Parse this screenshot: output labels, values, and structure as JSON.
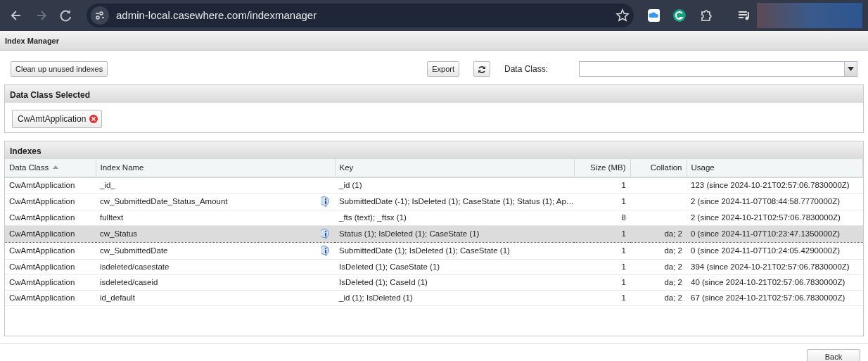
{
  "browser": {
    "url": "admin-local.casewhere.com/indexmanager"
  },
  "page": {
    "title": "Index Manager"
  },
  "toolbar": {
    "cleanup_button": "Clean up unused indexes",
    "export_button": "Export",
    "data_class_label": "Data Class:"
  },
  "selected_panel": {
    "title": "Data Class Selected",
    "tags": [
      "CwAmtApplication"
    ]
  },
  "indexes_panel": {
    "title": "Indexes",
    "columns": [
      {
        "label": "Data Class",
        "kind": "text",
        "sorted": true
      },
      {
        "label": "Index Name",
        "kind": "text",
        "sorted": false
      },
      {
        "label": "Key",
        "kind": "text",
        "sorted": false
      },
      {
        "label": "Size (MB)",
        "kind": "number",
        "sorted": false
      },
      {
        "label": "Collation",
        "kind": "number",
        "sorted": false
      },
      {
        "label": "Usage",
        "kind": "text",
        "sorted": false
      }
    ],
    "rows": [
      {
        "selected": false,
        "info": false,
        "cells": [
          "CwAmtApplication",
          "_id_",
          "_id (1)",
          "1",
          "",
          "123 (since 2024-10-21T02:57:06.7830000Z)"
        ]
      },
      {
        "selected": false,
        "info": true,
        "cells": [
          "CwAmtApplication",
          "cw_SubmittedDate_Status_Amount",
          "SubmittedDate (-1); IsDeleted (1); CaseState (1); Status (1); Ap…",
          "1",
          "",
          "2 (since 2024-11-07T08:44:58.7770000Z)"
        ]
      },
      {
        "selected": false,
        "info": false,
        "cells": [
          "CwAmtApplication",
          "fulltext",
          "_fts (text); _ftsx (1)",
          "8",
          "",
          "2 (since 2024-10-21T02:57:06.7830000Z)"
        ]
      },
      {
        "selected": true,
        "info": true,
        "cells": [
          "CwAmtApplication",
          "cw_Status",
          "Status (1); IsDeleted (1); CaseState (1)",
          "1",
          "da; 2",
          "0 (since 2024-11-07T10:23:47.1350000Z)"
        ]
      },
      {
        "selected": false,
        "info": true,
        "cells": [
          "CwAmtApplication",
          "cw_SubmittedDate",
          "SubmittedDate (1); IsDeleted (1); CaseState (1)",
          "1",
          "da; 2",
          "0 (since 2024-11-07T10:24:05.4290000Z)"
        ]
      },
      {
        "selected": false,
        "info": false,
        "cells": [
          "CwAmtApplication",
          "isdeleted/casestate",
          "IsDeleted (1); CaseState (1)",
          "1",
          "da; 2",
          "394 (since 2024-10-21T02:57:06.7830000Z)"
        ]
      },
      {
        "selected": false,
        "info": false,
        "cells": [
          "CwAmtApplication",
          "isdeleted/caseid",
          "IsDeleted (1); CaseId (1)",
          "1",
          "da; 2",
          "40 (since 2024-10-21T02:57:06.7830000Z)"
        ]
      },
      {
        "selected": false,
        "info": false,
        "cells": [
          "CwAmtApplication",
          "id_default",
          "_id (1); IsDeleted (1)",
          "1",
          "da; 2",
          "67 (since 2024-10-21T02:57:06.7830000Z)"
        ]
      }
    ]
  },
  "footer": {
    "back_button": "Back"
  }
}
